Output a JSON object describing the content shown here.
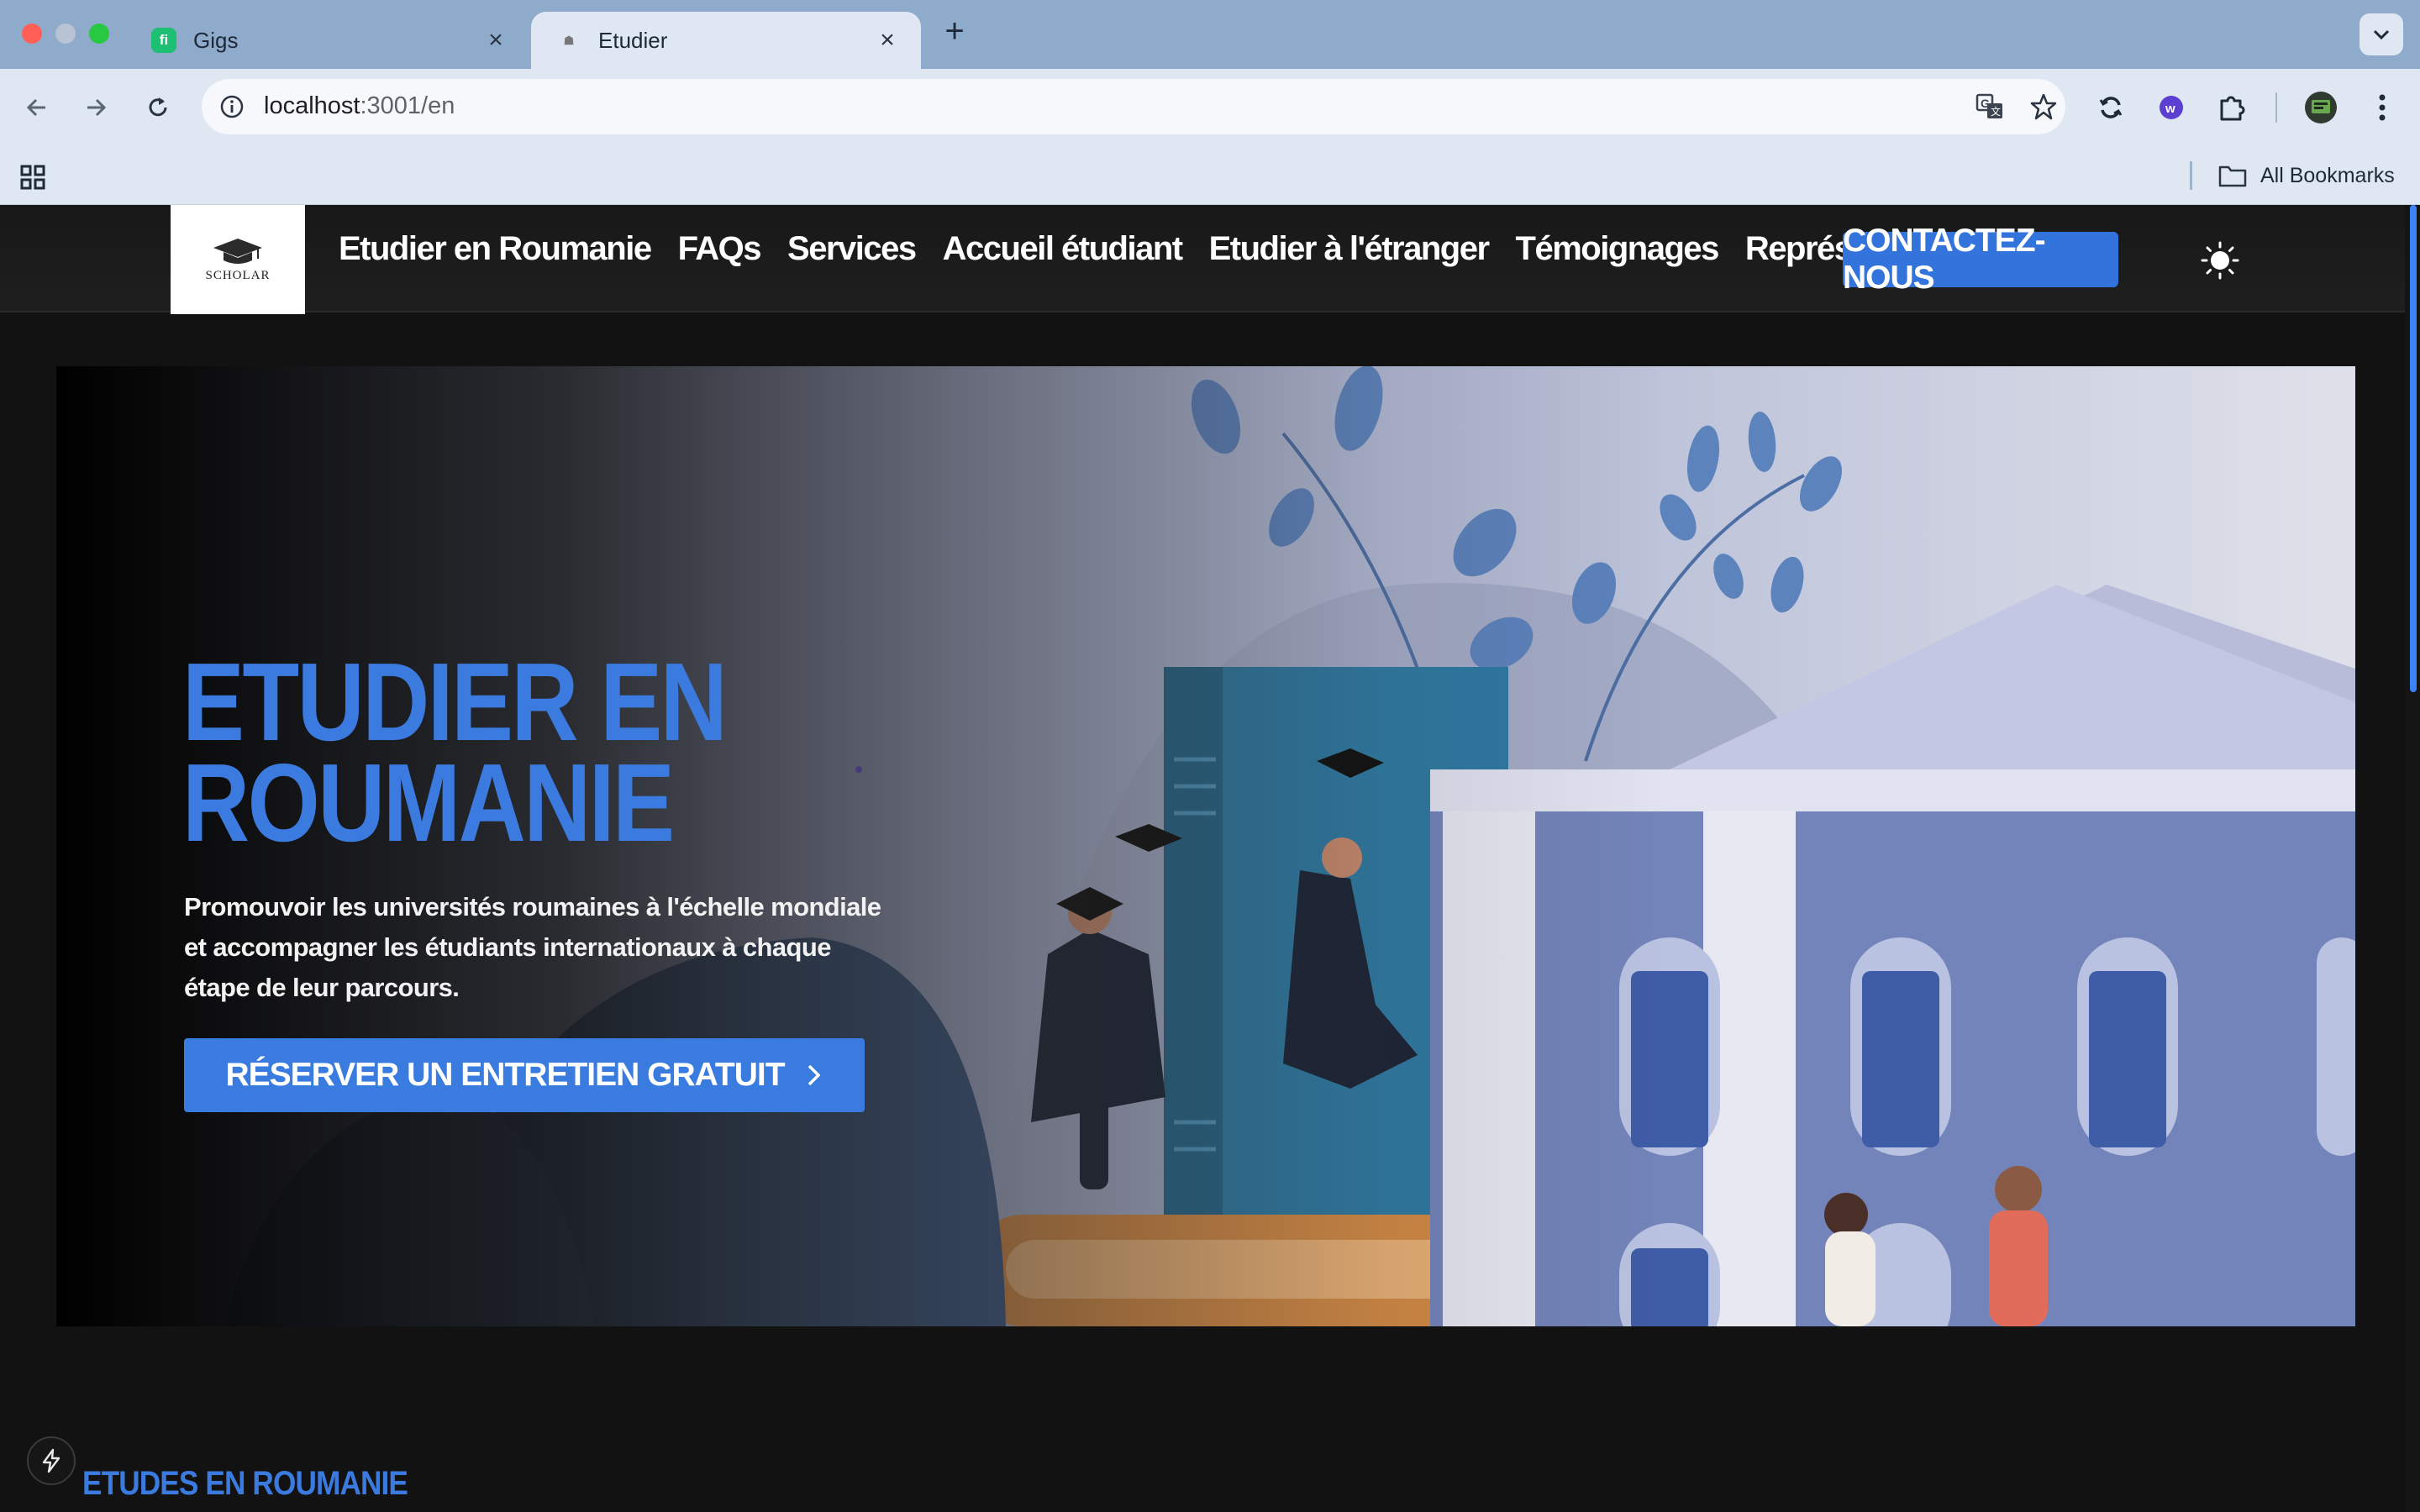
{
  "browser": {
    "tabs": [
      {
        "title": "Gigs",
        "favicon": "fiverr-icon",
        "active": false
      },
      {
        "title": "Etudier",
        "favicon": "scholar-favicon",
        "active": true
      }
    ],
    "address": {
      "host": "localhost",
      "path": ":3001/en"
    },
    "bookmarks_label": "All Bookmarks"
  },
  "site": {
    "logo_text": "SCHOLAR",
    "nav": [
      {
        "label": "Etudier en Roumanie"
      },
      {
        "label": "FAQs"
      },
      {
        "label": "Services"
      },
      {
        "label": "Accueil étudiant"
      },
      {
        "label": "Etudier à l'étranger"
      },
      {
        "label": "Témoignages"
      },
      {
        "label": "Représentations"
      }
    ],
    "cta_label": "CONTACTEZ-NOUS",
    "theme_icon": "sun-icon"
  },
  "hero": {
    "title": "ETUDIER EN ROUMANIE",
    "subtitle": "Promouvoir les universités roumaines à l'échelle mondiale et accompagner les étudiants internationaux à chaque étape de leur parcours.",
    "button_label": "RÉSERVER UN ENTRETIEN GRATUIT"
  },
  "section": {
    "title": "ETUDES EN ROUMANIE"
  },
  "colors": {
    "accent": "#3273dc",
    "background": "#121212",
    "chrome": "#dfe8f2",
    "tabstrip": "#8fabcb"
  }
}
